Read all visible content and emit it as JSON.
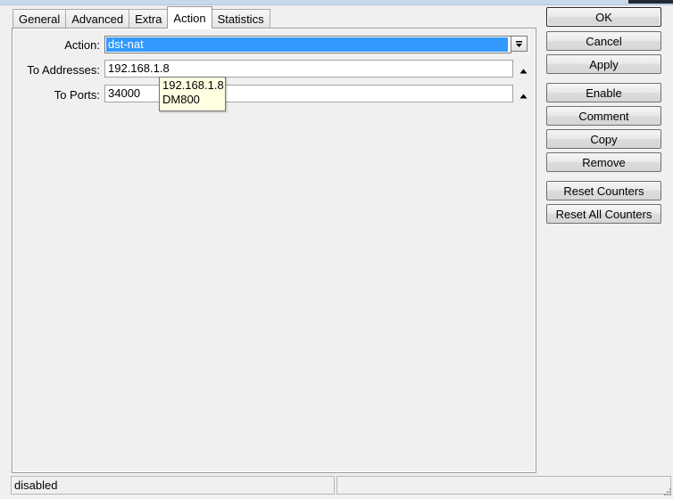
{
  "tabs": [
    {
      "label": "General"
    },
    {
      "label": "Advanced"
    },
    {
      "label": "Extra"
    },
    {
      "label": "Action"
    },
    {
      "label": "Statistics"
    }
  ],
  "active_tab": "Action",
  "form": {
    "action": {
      "label": "Action:",
      "value": "dst-nat"
    },
    "to_addresses": {
      "label": "To Addresses:",
      "value": "192.168.1.8"
    },
    "to_ports": {
      "label": "To Ports:",
      "value": "34000"
    }
  },
  "tooltip": {
    "line1": "192.168.1.8",
    "line2": "DM800"
  },
  "buttons": {
    "ok": "OK",
    "cancel": "Cancel",
    "apply": "Apply",
    "enable": "Enable",
    "comment": "Comment",
    "copy": "Copy",
    "remove": "Remove",
    "reset_counters": "Reset Counters",
    "reset_all_counters": "Reset All Counters"
  },
  "status": {
    "left": "disabled",
    "right": ""
  },
  "colors": {
    "selection": "#3399ff",
    "tooltip_bg": "#ffffe1",
    "window_bg": "#f0f0f0"
  },
  "icons": [
    "dropdown-arrow-icon",
    "up-arrow-icon",
    "resize-grip-icon"
  ]
}
